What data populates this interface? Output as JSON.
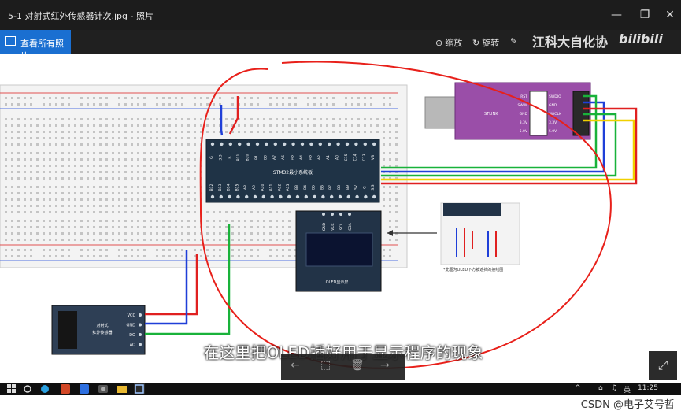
{
  "window": {
    "title": "5-1 对射式红外传感器计次.jpg - 照片",
    "controls": [
      "—",
      "❐",
      "✕"
    ]
  },
  "toolbar": {
    "all_photos": "查看所有照片",
    "zoom": "缩放",
    "rotate": "旋转",
    "watermark_text": "江科大自化协",
    "watermark_logo": "bilibili"
  },
  "diagram": {
    "stm32_label": "STM32最小系统板",
    "stm32_top_pins": [
      "G",
      "3.3",
      "R",
      "B11",
      "B10",
      "B1",
      "B0",
      "A7",
      "A6",
      "A5",
      "A4",
      "A3",
      "A2",
      "A1",
      "A0",
      "C15",
      "C14",
      "C13",
      "VB"
    ],
    "stm32_bottom_pins": [
      "B12",
      "B13",
      "B14",
      "B15",
      "A8",
      "A9",
      "A10",
      "A11",
      "A12",
      "A15",
      "B3",
      "B4",
      "B5",
      "B6",
      "B7",
      "B8",
      "B9",
      "5V",
      "G",
      "3.3"
    ],
    "stlink_label": "STLINK",
    "stlink_pins_left": [
      "RST",
      "SWIM",
      "GND",
      "3.3V",
      "5.0V"
    ],
    "stlink_pins_right": [
      "SWDIO",
      "GND",
      "SWCLK",
      "3.3V",
      "5.0V"
    ],
    "oled_pins": [
      "GND",
      "VCC",
      "SCL",
      "SDA"
    ],
    "oled_label": "OLED显示屏",
    "sensor_label": "对射式\n红外传感器",
    "sensor_pins": [
      "VCC",
      "GND",
      "DO",
      "AO"
    ],
    "side_note": "*此图为OLED下方被遮挡的接线图"
  },
  "subtitle": "在这里把OLED插好用于显示程序的现象",
  "controls": [
    "←",
    "⬚",
    "🗑",
    "→"
  ],
  "taskbar": {
    "time": "11:25",
    "tray": [
      "^",
      "⌂",
      "♫",
      "英"
    ]
  },
  "credit": "CSDN @电子艾号哲",
  "colors": {
    "accent": "#1a6fd1",
    "wire_red": "#e02020",
    "wire_blue": "#1f3fd8",
    "wire_green": "#19b23a",
    "wire_yellow": "#f0d000",
    "annotation": "#e8201a"
  }
}
